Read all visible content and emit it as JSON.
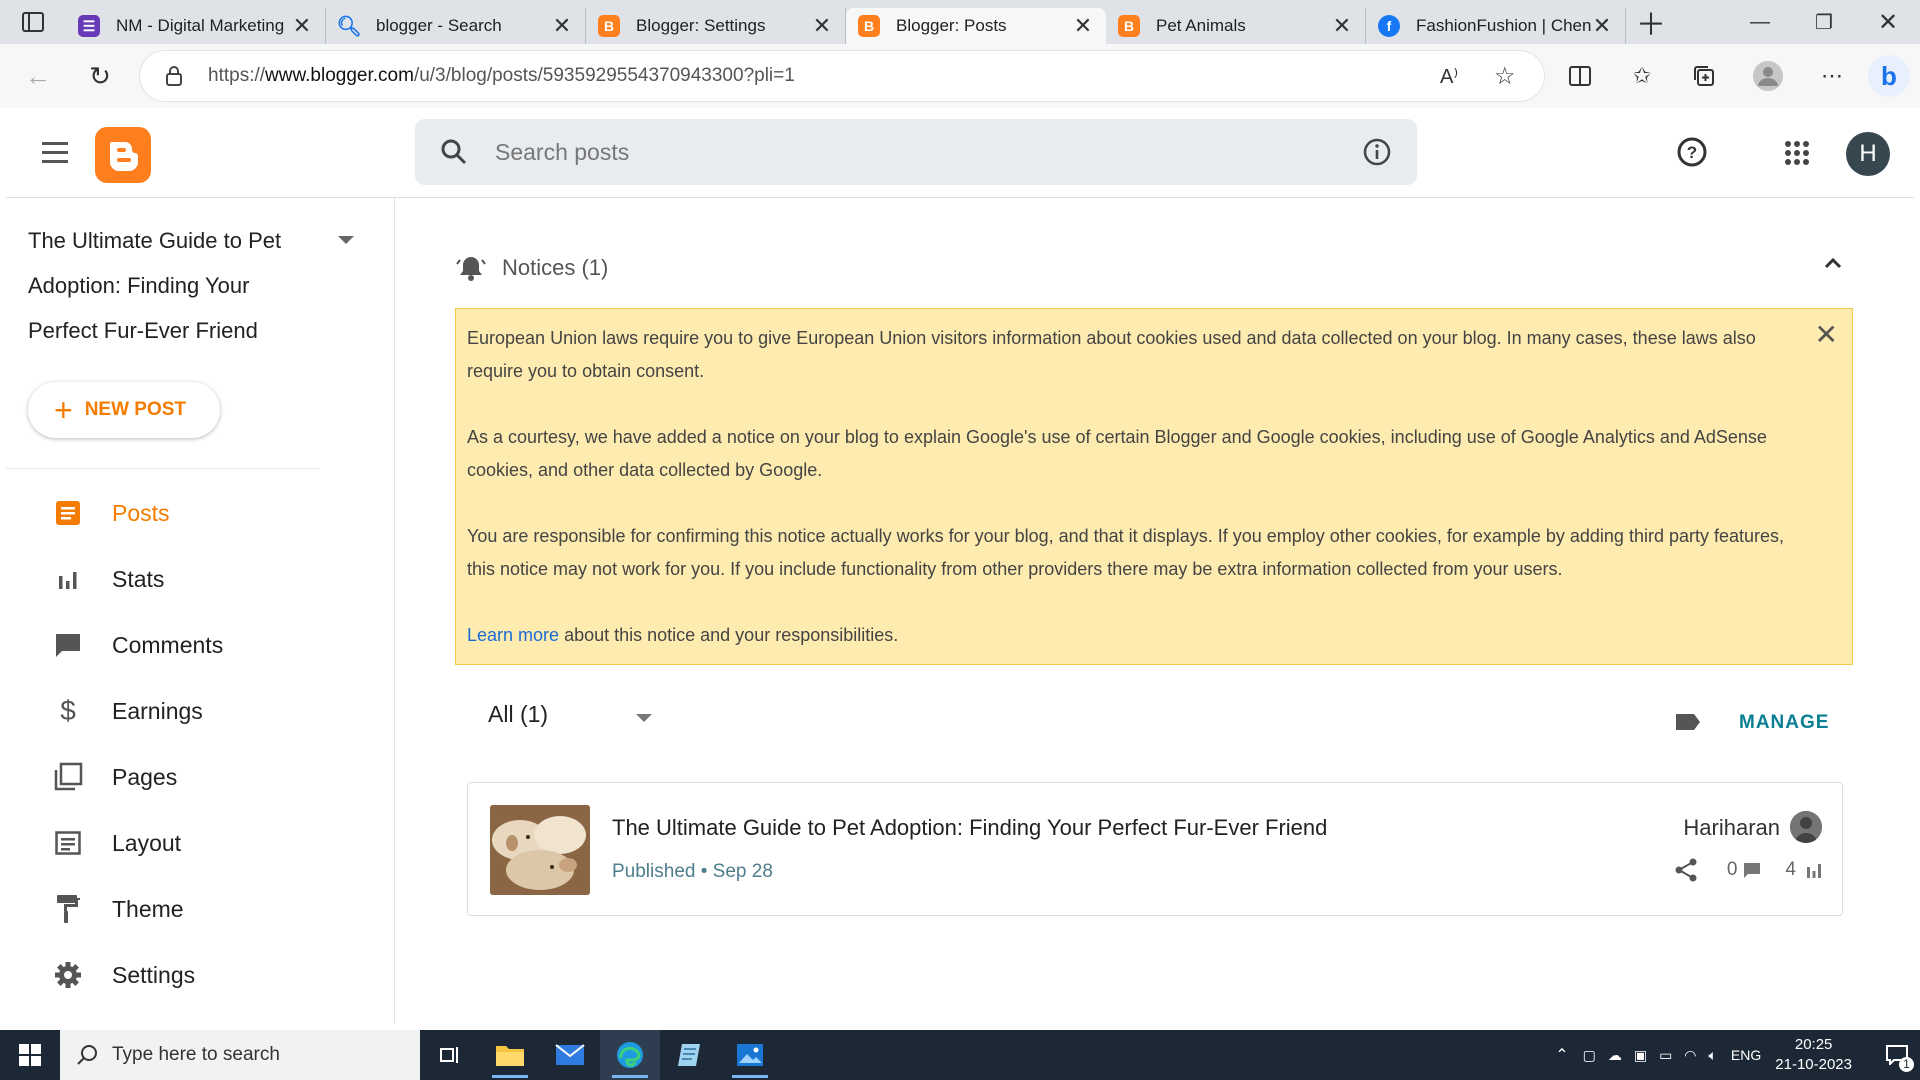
{
  "browser": {
    "tabs": [
      {
        "label": "NM - Digital Marketing",
        "favicon_color": "#673ab7",
        "active": false
      },
      {
        "label": "blogger - Search",
        "favicon_color": "#1a73e8",
        "active": false
      },
      {
        "label": "Blogger: Settings",
        "favicon_color": "#ff7f1f",
        "active": false
      },
      {
        "label": "Blogger: Posts",
        "favicon_color": "#ff7f1f",
        "active": true
      },
      {
        "label": "Pet Animals",
        "favicon_color": "#ff7f1f",
        "active": false
      },
      {
        "label": "FashionFushion | Chenn",
        "favicon_color": "#1877f2",
        "active": false
      }
    ],
    "url_prefix": "https://",
    "url_host": "www.blogger.com",
    "url_path": "/u/3/blog/posts/5935929554370943300?pli=1"
  },
  "header": {
    "search_placeholder": "Search posts",
    "avatar_letter": "H",
    "brand_color": "#ff7f1f"
  },
  "sidebar": {
    "blog_title": "The Ultimate Guide to Pet Adoption: Finding Your Perfect Fur-Ever Friend",
    "new_post_label": "NEW POST",
    "items": [
      {
        "label": "Posts",
        "icon": "posts-icon",
        "active": true
      },
      {
        "label": "Stats",
        "icon": "stats-icon",
        "active": false
      },
      {
        "label": "Comments",
        "icon": "comments-icon",
        "active": false
      },
      {
        "label": "Earnings",
        "icon": "earnings-icon",
        "active": false
      },
      {
        "label": "Pages",
        "icon": "pages-icon",
        "active": false
      },
      {
        "label": "Layout",
        "icon": "layout-icon",
        "active": false
      },
      {
        "label": "Theme",
        "icon": "theme-icon",
        "active": false
      },
      {
        "label": "Settings",
        "icon": "settings-icon",
        "active": false
      }
    ]
  },
  "notices": {
    "heading": "Notices (1)",
    "paragraph1": "European Union laws require you to give European Union visitors information about cookies used and data collected on your blog. In many cases, these laws also require you to obtain consent.",
    "paragraph2": "As a courtesy, we have added a notice on your blog to explain Google's use of certain Blogger and Google cookies, including use of Google Analytics and AdSense cookies, and other data collected by Google.",
    "paragraph3": "You are responsible for confirming this notice actually works for your blog, and that it displays. If you employ other cookies, for example by adding third party features, this notice may not work for you. If you include functionality from other providers there may be extra information collected from your users.",
    "learn_more": "Learn more",
    "learn_more_suffix": " about this notice and your responsibilities."
  },
  "posts": {
    "filter_label": "All (1)",
    "manage_label": "MANAGE",
    "items": [
      {
        "title": "The Ultimate Guide to Pet Adoption: Finding Your Perfect Fur-Ever Friend",
        "status": "Published",
        "date": "Sep 28",
        "author": "Hariharan",
        "comments": "0",
        "views": "4"
      }
    ]
  },
  "taskbar": {
    "search_placeholder": "Type here to search",
    "language": "ENG",
    "time": "20:25",
    "date": "21-10-2023",
    "notification_count": "1"
  }
}
